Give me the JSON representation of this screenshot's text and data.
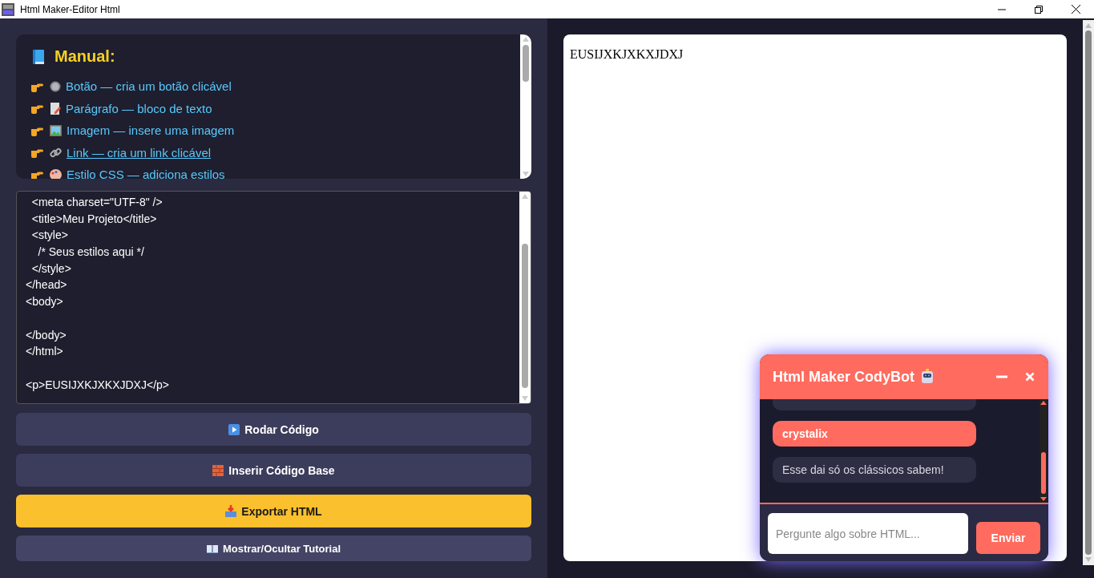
{
  "window": {
    "title": "Html Maker-Editor Html"
  },
  "manual": {
    "title": "Manual:",
    "items": [
      {
        "text": "Botão — cria um botão clicável",
        "kind": "text"
      },
      {
        "text": "Parágrafo — bloco de texto",
        "kind": "text"
      },
      {
        "text": "Imagem — insere uma imagem",
        "kind": "text"
      },
      {
        "text": "Link — cria um link clicável",
        "kind": "link"
      },
      {
        "text": "Estilo CSS — adiciona estilos",
        "kind": "text"
      }
    ]
  },
  "editor": {
    "lines": [
      {
        "kind": "code",
        "text": "  <meta charset=\"UTF-8\" />"
      },
      {
        "kind": "code",
        "text": "  <title>Meu Projeto</title>"
      },
      {
        "kind": "code",
        "text": "  <style>"
      },
      {
        "kind": "code",
        "text": "    /* Seus estilos aqui */"
      },
      {
        "kind": "code",
        "text": "  </style>"
      },
      {
        "kind": "code",
        "text": "</head>"
      },
      {
        "kind": "code",
        "text": "<body>"
      },
      {
        "kind": "blank"
      },
      {
        "kind": "code",
        "text": "</body>"
      },
      {
        "kind": "code",
        "text": "</html>"
      },
      {
        "kind": "blank"
      },
      {
        "kind": "code",
        "text": "<p>EUSIJXKJXKXJDXJ</p>"
      }
    ]
  },
  "buttons": [
    {
      "label": "Rodar Código",
      "kind": "normal"
    },
    {
      "label": "Inserir Código Base",
      "kind": "normal"
    },
    {
      "label": "Exportar HTML",
      "kind": "primary"
    },
    {
      "label": "Mostrar/Ocultar Tutorial",
      "kind": "small"
    }
  ],
  "preview": {
    "text": "EUSIJXKJXKXJDXJ"
  },
  "chat": {
    "title": "Html Maker CodyBot",
    "messages": [
      {
        "kind": "bot"
      },
      {
        "kind": "user",
        "text": "crystalix"
      },
      {
        "kind": "bot",
        "text": "Esse dai só os clássicos sabem!"
      }
    ],
    "placeholder": "Pergunte algo sobre HTML...",
    "send": "Enviar"
  }
}
